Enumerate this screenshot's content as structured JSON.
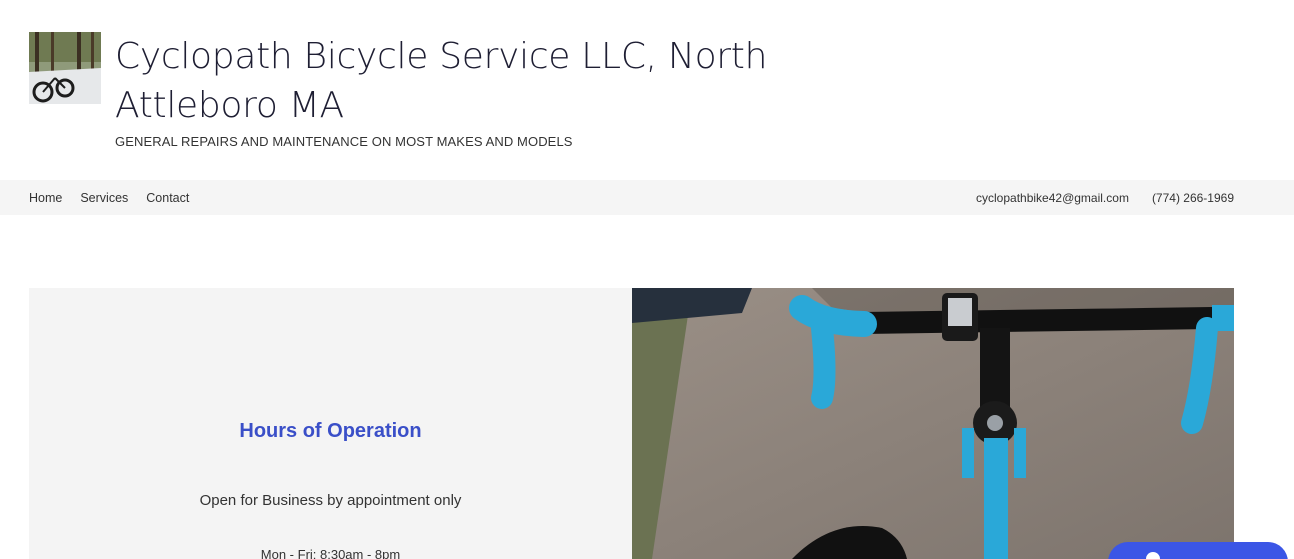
{
  "header": {
    "title": "Cyclopath Bicycle Service LLC,   North Attleboro MA",
    "tagline": "GENERAL  REPAIRS AND MAINTENANCE ON MOST MAKES AND MODELS"
  },
  "nav": {
    "links": [
      "Home",
      "Services",
      "Contact"
    ],
    "email": "cyclopathbike42@gmail.com",
    "phone": "(774) 266-1969"
  },
  "hours": {
    "title": "Hours of Operation",
    "note": "Open for Business by appointment only",
    "times": "Mon - Fri: 8:30am - 8pm"
  },
  "colors": {
    "accent": "#3a4fc8",
    "nav_bg": "#f5f5f5",
    "panel_bg": "#f4f4f4",
    "chat_button": "#3b56e6"
  },
  "icons": {
    "logo": "bicycle-in-snow-photo",
    "hero": "handlebar-photo",
    "chat": "chat-icon"
  }
}
